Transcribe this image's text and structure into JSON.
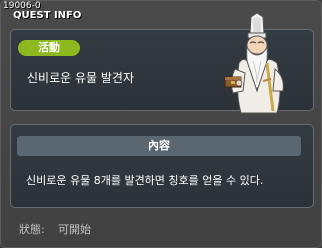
{
  "window": {
    "quest_id": "19006-0",
    "title": "QUEST INFO"
  },
  "quest": {
    "badge_label": "活動",
    "name": "신비로운 유물 발견자"
  },
  "content": {
    "header": "內容",
    "text": "신비로운 유물 8개를 발견하면 칭호를 얻을 수 있다."
  },
  "status": {
    "label": "狀態:",
    "value": "可開始"
  },
  "colors": {
    "badge": "#8cba1e",
    "panel_bg": "#303840",
    "content_header_bg": "#5a6770"
  },
  "icons": {
    "npc": "old-sage-npc-icon"
  }
}
